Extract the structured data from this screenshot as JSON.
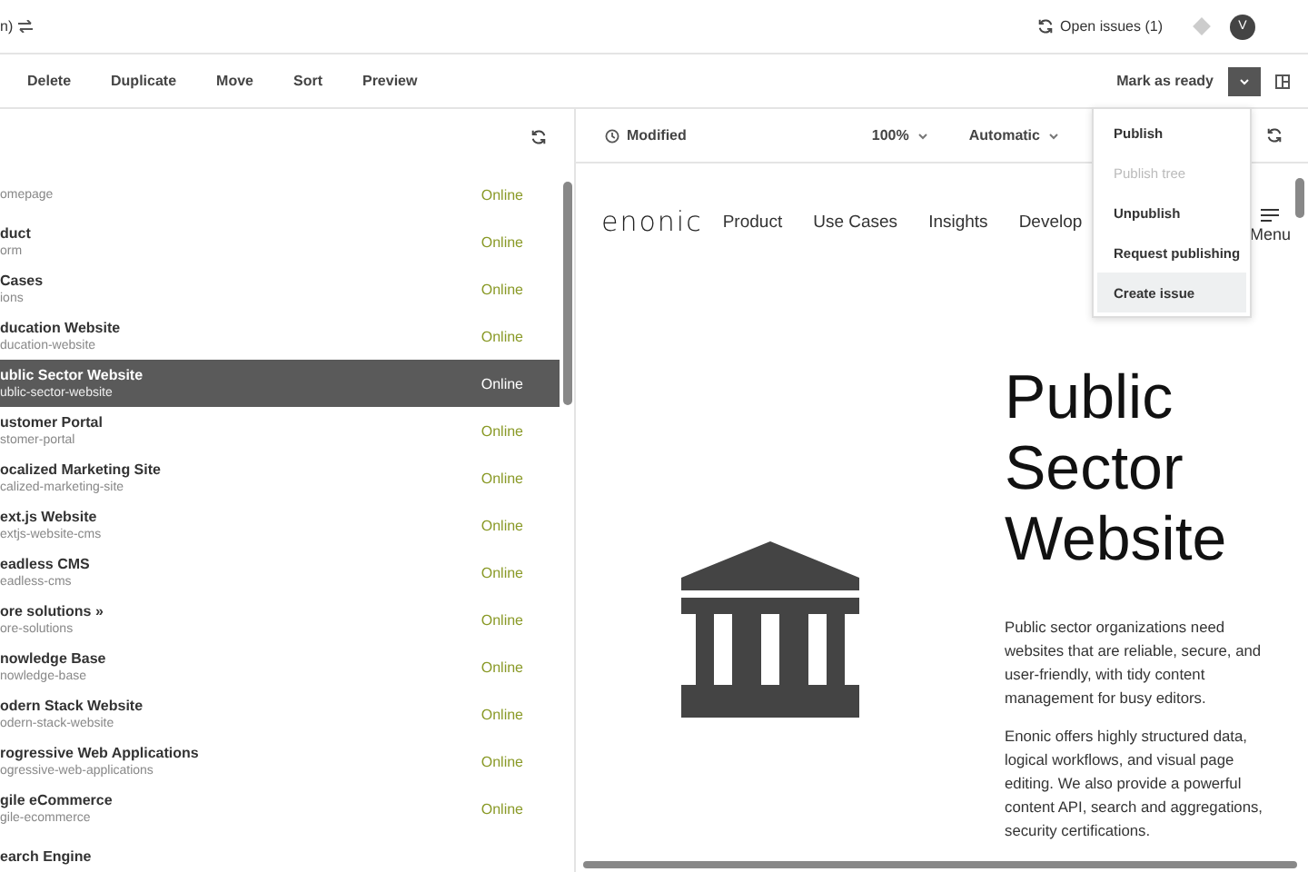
{
  "top_bar": {
    "title_fragment": "n)",
    "issues_link": "Open issues (1)",
    "avatar": "V"
  },
  "toolbar": {
    "actions": [
      "Delete",
      "Duplicate",
      "Move",
      "Sort",
      "Preview"
    ],
    "primary": "Mark as ready"
  },
  "tree": {
    "rows": [
      {
        "name": "",
        "path": "omepage",
        "status": "Online",
        "selected": false
      },
      {
        "name": "duct",
        "path": "orm",
        "status": "Online",
        "selected": false
      },
      {
        "name": "Cases",
        "path": "ions",
        "status": "Online",
        "selected": false
      },
      {
        "name": "ducation Website",
        "path": "ducation-website",
        "status": "Online",
        "selected": false
      },
      {
        "name": "ublic Sector Website",
        "path": "ublic-sector-website",
        "status": "Online",
        "selected": true
      },
      {
        "name": "ustomer Portal",
        "path": "stomer-portal",
        "status": "Online",
        "selected": false
      },
      {
        "name": "ocalized Marketing Site",
        "path": "calized-marketing-site",
        "status": "Online",
        "selected": false
      },
      {
        "name": "ext.js Website",
        "path": "extjs-website-cms",
        "status": "Online",
        "selected": false
      },
      {
        "name": "eadless CMS",
        "path": "eadless-cms",
        "status": "Online",
        "selected": false
      },
      {
        "name": "ore solutions »",
        "path": "ore-solutions",
        "status": "Online",
        "selected": false
      },
      {
        "name": "nowledge Base",
        "path": "nowledge-base",
        "status": "Online",
        "selected": false
      },
      {
        "name": "odern Stack Website",
        "path": "odern-stack-website",
        "status": "Online",
        "selected": false
      },
      {
        "name": "rogressive Web Applications",
        "path": "ogressive-web-applications",
        "status": "Online",
        "selected": false
      },
      {
        "name": "gile eCommerce",
        "path": "gile-ecommerce",
        "status": "Online",
        "selected": false
      },
      {
        "name": "earch Engine",
        "path": "",
        "status": "",
        "selected": false
      }
    ]
  },
  "preview_bar": {
    "status": "Modified",
    "zoom": "100%",
    "mode": "Automatic"
  },
  "dropdown_menu": [
    {
      "label": "Publish",
      "disabled": false,
      "selected": false
    },
    {
      "label": "Publish tree",
      "disabled": true,
      "selected": false
    },
    {
      "label": "Unpublish",
      "disabled": false,
      "selected": false
    },
    {
      "label": "Request publishing",
      "disabled": false,
      "selected": false
    },
    {
      "label": "Create issue",
      "disabled": false,
      "selected": true
    }
  ],
  "preview": {
    "logo": "enonic",
    "nav": [
      "Product",
      "Use Cases",
      "Insights",
      "Develop"
    ],
    "menu_label": "Menu",
    "title_lines": [
      "Public",
      "Sector",
      "Website"
    ],
    "paragraphs": [
      "Public sector organizations need websites that are reliable, secure, and user-friendly, with tidy content management for busy editors.",
      "Enonic offers highly structured data, logical workflows, and visual page editing. We also provide a powerful content API, search and aggregations, security certifications."
    ]
  }
}
